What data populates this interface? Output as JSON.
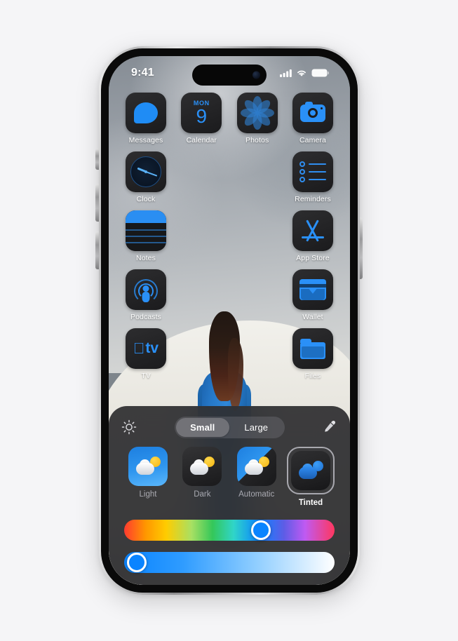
{
  "status_bar": {
    "time": "9:41",
    "cellular_icon": "cellular-signal-icon",
    "wifi_icon": "wifi-icon",
    "battery_icon": "battery-icon"
  },
  "home_screen": {
    "rows": [
      [
        {
          "label": "Messages",
          "icon": "messages-icon"
        },
        {
          "label": "Calendar",
          "icon": "calendar-icon",
          "weekday": "MON",
          "day": "9"
        },
        {
          "label": "Photos",
          "icon": "photos-icon"
        },
        {
          "label": "Camera",
          "icon": "camera-icon"
        }
      ],
      [
        {
          "label": "Clock",
          "icon": "clock-icon"
        },
        {
          "label": "",
          "icon": ""
        },
        {
          "label": "",
          "icon": ""
        },
        {
          "label": "Reminders",
          "icon": "reminders-icon"
        }
      ],
      [
        {
          "label": "Notes",
          "icon": "notes-icon"
        },
        {
          "label": "",
          "icon": ""
        },
        {
          "label": "",
          "icon": ""
        },
        {
          "label": "App Store",
          "icon": "app-store-icon"
        }
      ],
      [
        {
          "label": "Podcasts",
          "icon": "podcasts-icon"
        },
        {
          "label": "",
          "icon": ""
        },
        {
          "label": "",
          "icon": ""
        },
        {
          "label": "Wallet",
          "icon": "wallet-icon"
        }
      ],
      [
        {
          "label": "TV",
          "icon": "tv-icon"
        },
        {
          "label": "",
          "icon": ""
        },
        {
          "label": "",
          "icon": ""
        },
        {
          "label": "Files",
          "icon": "files-icon"
        }
      ]
    ]
  },
  "customize_panel": {
    "brightness_icon": "sun-brightness-icon",
    "eyedropper_icon": "eyedropper-icon",
    "size_segments": [
      {
        "label": "Small",
        "selected": true
      },
      {
        "label": "Large",
        "selected": false
      }
    ],
    "appearance_options": [
      {
        "label": "Light",
        "selected": false
      },
      {
        "label": "Dark",
        "selected": false
      },
      {
        "label": "Automatic",
        "selected": false
      },
      {
        "label": "Tinted",
        "selected": true
      }
    ],
    "hue_slider": {
      "name": "hue-slider",
      "value_percent": 65
    },
    "brightness_slider": {
      "name": "tint-brightness-slider",
      "value_percent": 6
    },
    "accent_color": "#0a84ff"
  }
}
